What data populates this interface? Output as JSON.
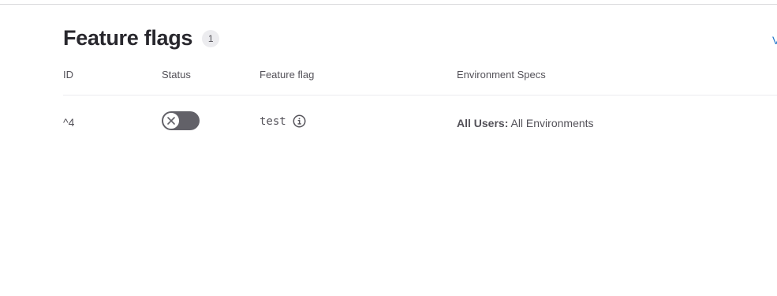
{
  "header": {
    "title": "Feature flags",
    "count": "1",
    "edge_link": "V"
  },
  "table": {
    "columns": [
      "ID",
      "Status",
      "Feature flag",
      "Environment Specs"
    ],
    "rows": [
      {
        "id": "^4",
        "status": "off",
        "status_icon": "close-icon",
        "flag_name": "test",
        "flag_info_icon": "info-icon",
        "env_scope_label": "All Users:",
        "env_scope_value": "All Environments"
      }
    ]
  },
  "colors": {
    "toggle_off": "#626168",
    "link": "#1f75cb",
    "badge_bg": "#ececef"
  }
}
